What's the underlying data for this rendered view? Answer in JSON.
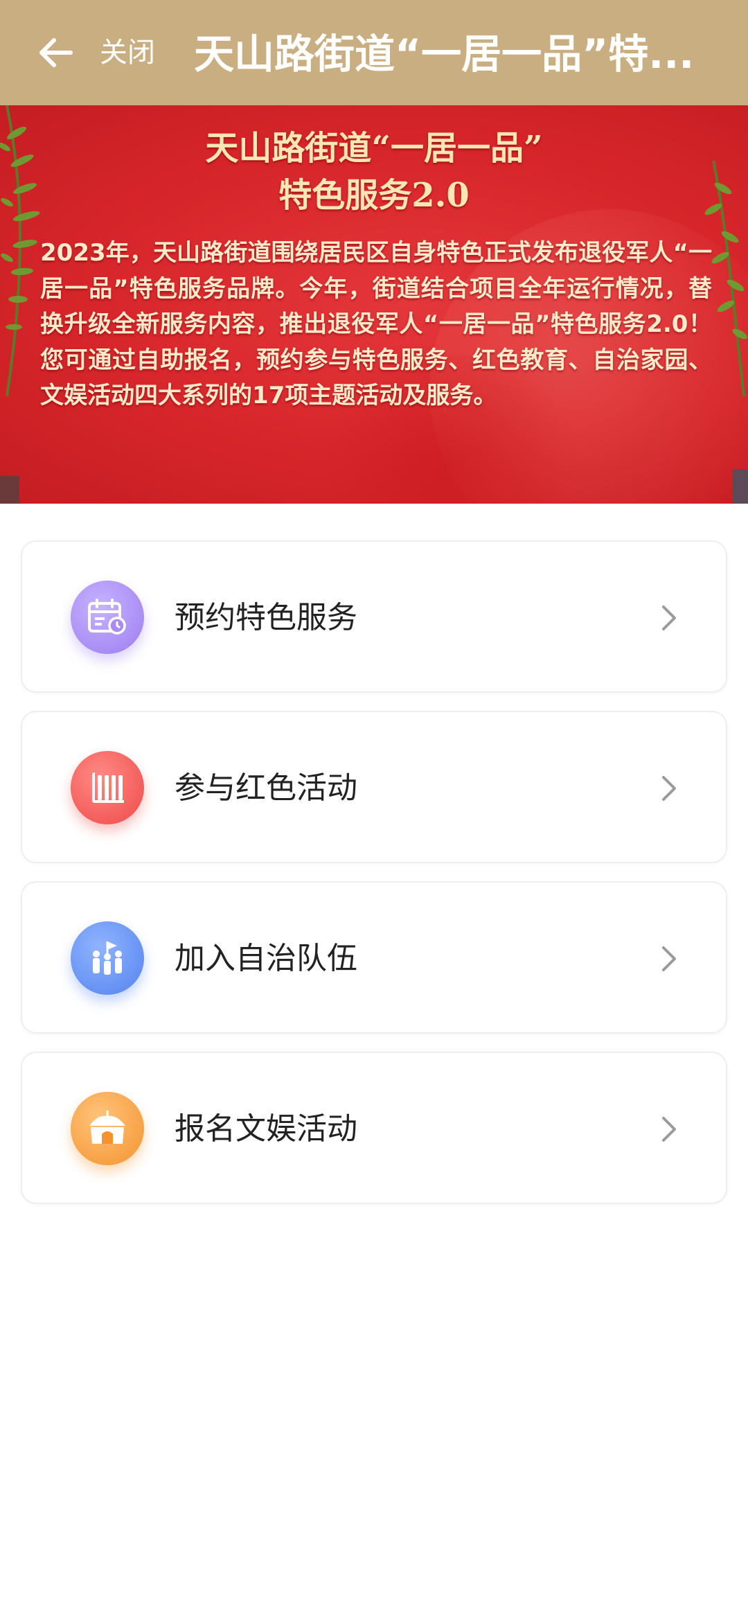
{
  "header": {
    "back_icon": "arrow-left-icon",
    "close_label": "关闭",
    "title": "天山路街道“一居一品”特..."
  },
  "banner": {
    "title_line1": "天山路街道“一居一品”",
    "title_line2": "特色服务2.0",
    "description": "2023年，天山路街道围绕居民区自身特色正式发布退役军人“一居一品”特色服务品牌。今年，街道结合项目全年运行情况，替换升级全新服务内容，推出退役军人“一居一品”特色服务2.0！您可通过自助报名，预约参与特色服务、红色教育、自治家园、文娱活动四大系列的17项主题活动及服务。",
    "colors": {
      "background": "#d7262b",
      "text": "#fbe7b6"
    }
  },
  "menu": [
    {
      "label": "预约特色服务",
      "icon": "calendar-clock-icon",
      "color": "#a98cf3"
    },
    {
      "label": "参与红色活动",
      "icon": "red-flag-icon",
      "color": "#f25a5a"
    },
    {
      "label": "加入自治队伍",
      "icon": "team-people-icon",
      "color": "#5a8cf0"
    },
    {
      "label": "报名文娱活动",
      "icon": "tent-stage-icon",
      "color": "#f7a13c"
    }
  ],
  "colors": {
    "topbar": "#c8ae80",
    "chevron": "#999999"
  }
}
